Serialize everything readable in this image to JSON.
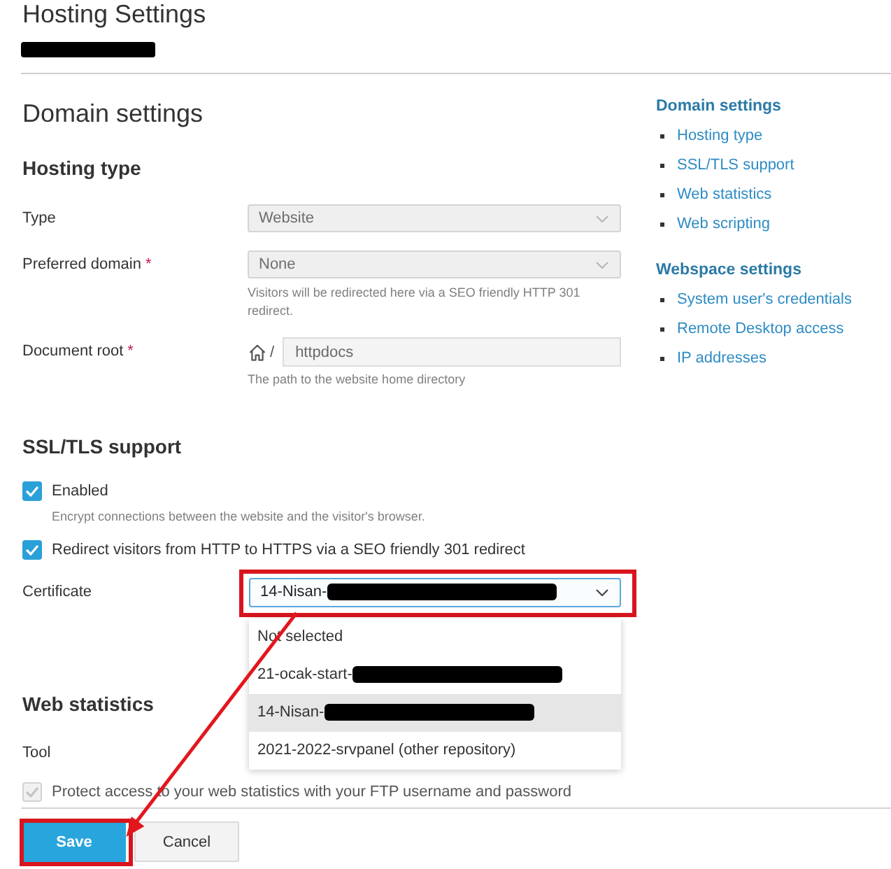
{
  "page": {
    "title": "Hosting Settings",
    "subtitle": {
      "redacted": true
    }
  },
  "main_heading": "Domain settings",
  "hosting_type": {
    "heading": "Hosting type",
    "fields": [
      {
        "kind": "select",
        "label": "Type",
        "value": "Website",
        "disabled": true
      },
      {
        "kind": "select",
        "label": "Preferred domain",
        "required_mark": "*",
        "value": "None",
        "disabled": true,
        "hint": "Visitors will be redirected here via a SEO friendly HTTP 301 redirect."
      },
      {
        "kind": "path",
        "label": "Document root",
        "required_mark": "*",
        "prefix": "/",
        "value": "httpdocs",
        "disabled": true,
        "hint": "The path to the website home directory"
      }
    ]
  },
  "ssl_tls": {
    "heading": "SSL/TLS support",
    "options": [
      {
        "label": "Enabled",
        "checked": true,
        "disabled": false,
        "hint": "Encrypt connections between the website and the visitor's browser."
      },
      {
        "label": "Redirect visitors from HTTP to HTTPS via a SEO friendly 301 redirect",
        "checked": true,
        "disabled": false
      }
    ],
    "certificate": {
      "label": "Certificate",
      "value": "14-Nisan-",
      "redacted": true,
      "expanded": true,
      "highlighted": true,
      "options": [
        {
          "label": "Not selected",
          "redacted": false,
          "selected": false
        },
        {
          "label": "21-ocak-start-",
          "redacted": true,
          "selected": false
        },
        {
          "label": "14-Nisan-",
          "redacted": true,
          "selected": true
        },
        {
          "label": "2021-2022-srvpanel (other repository)",
          "redacted": false,
          "selected": false
        }
      ]
    }
  },
  "web_statistics": {
    "heading": "Web statistics",
    "tool_label": "Tool",
    "options": [
      {
        "label": "Protect access to your web statistics with your FTP username and password",
        "checked": true,
        "disabled": true
      }
    ]
  },
  "sidebar": {
    "groups": [
      {
        "title": "Domain settings",
        "links": [
          "Hosting type",
          "SSL/TLS support",
          "Web statistics",
          "Web scripting"
        ]
      },
      {
        "title": "Webspace settings",
        "links": [
          "System user's credentials",
          "Remote Desktop access",
          "IP addresses"
        ]
      }
    ]
  },
  "buttons": [
    {
      "label": "Save",
      "kind": "primary",
      "highlighted": true
    },
    {
      "label": "Cancel",
      "kind": "secondary",
      "highlighted": false
    }
  ],
  "annotations": [
    {
      "kind": "arrow"
    }
  ]
}
